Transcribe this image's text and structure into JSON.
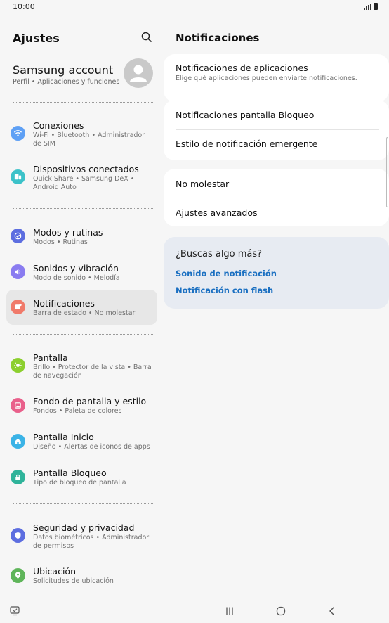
{
  "status_bar": {
    "time": "10:00"
  },
  "settings": {
    "title": "Ajustes",
    "account": {
      "name": "Samsung account",
      "subtitle": "Perfil  •  Aplicaciones y funciones"
    },
    "items": [
      {
        "title": "Conexiones",
        "subtitle": "Wi-Fi  •  Bluetooth  •  Administrador de SIM",
        "icon": "wifi-icon",
        "color": "#5ea0f5"
      },
      {
        "title": "Dispositivos conectados",
        "subtitle": "Quick Share  •  Samsung DeX  •  Android Auto",
        "icon": "devices-icon",
        "color": "#3cc2c9"
      },
      {
        "title": "Modos y rutinas",
        "subtitle": "Modos  •  Rutinas",
        "icon": "modes-check-icon",
        "color": "#5d6ee0"
      },
      {
        "title": "Sonidos y vibración",
        "subtitle": "Modo de sonido  •  Melodía",
        "icon": "speaker-icon",
        "color": "#8a7cf0"
      },
      {
        "title": "Notificaciones",
        "subtitle": "Barra de estado  •  No molestar",
        "icon": "notification-icon",
        "color": "#f07a6a"
      },
      {
        "title": "Pantalla",
        "subtitle": "Brillo  •  Protector de la vista  •  Barra de navegación",
        "icon": "brightness-icon",
        "color": "#8ccf2e"
      },
      {
        "title": "Fondo de pantalla y estilo",
        "subtitle": "Fondos  •  Paleta de colores",
        "icon": "wallpaper-icon",
        "color": "#e9608b"
      },
      {
        "title": "Pantalla Inicio",
        "subtitle": "Diseño  •  Alertas de iconos de apps",
        "icon": "home-icon",
        "color": "#3bb3e6"
      },
      {
        "title": "Pantalla Bloqueo",
        "subtitle": "Tipo de bloqueo de pantalla",
        "icon": "lock-icon",
        "color": "#2fb39a"
      },
      {
        "title": "Seguridad y privacidad",
        "subtitle": "Datos biométricos  •  Administrador de permisos",
        "icon": "shield-icon",
        "color": "#5d6ee0"
      },
      {
        "title": "Ubicación",
        "subtitle": "Solicitudes de ubicación",
        "icon": "location-icon",
        "color": "#5fb55a"
      }
    ]
  },
  "notifications": {
    "title": "Notificaciones",
    "app_notifications": {
      "title": "Notificaciones de aplicaciones",
      "subtitle": "Elige qué aplicaciones pueden enviarte notificaciones."
    },
    "lock_screen": "Notificaciones pantalla Bloqueo",
    "popup_style": "Estilo de notificación emergente",
    "do_not_disturb": "No molestar",
    "advanced": "Ajustes avanzados",
    "suggestions": {
      "title": "¿Buscas algo más?",
      "links": [
        "Sonido de notificación",
        "Notificación con flash"
      ]
    }
  },
  "colors": {
    "accent_link": "#1a6fc1",
    "selected_bg": "#e7e7e7",
    "card_bg": "#ffffff",
    "suggest_bg": "#e7ebf2"
  }
}
